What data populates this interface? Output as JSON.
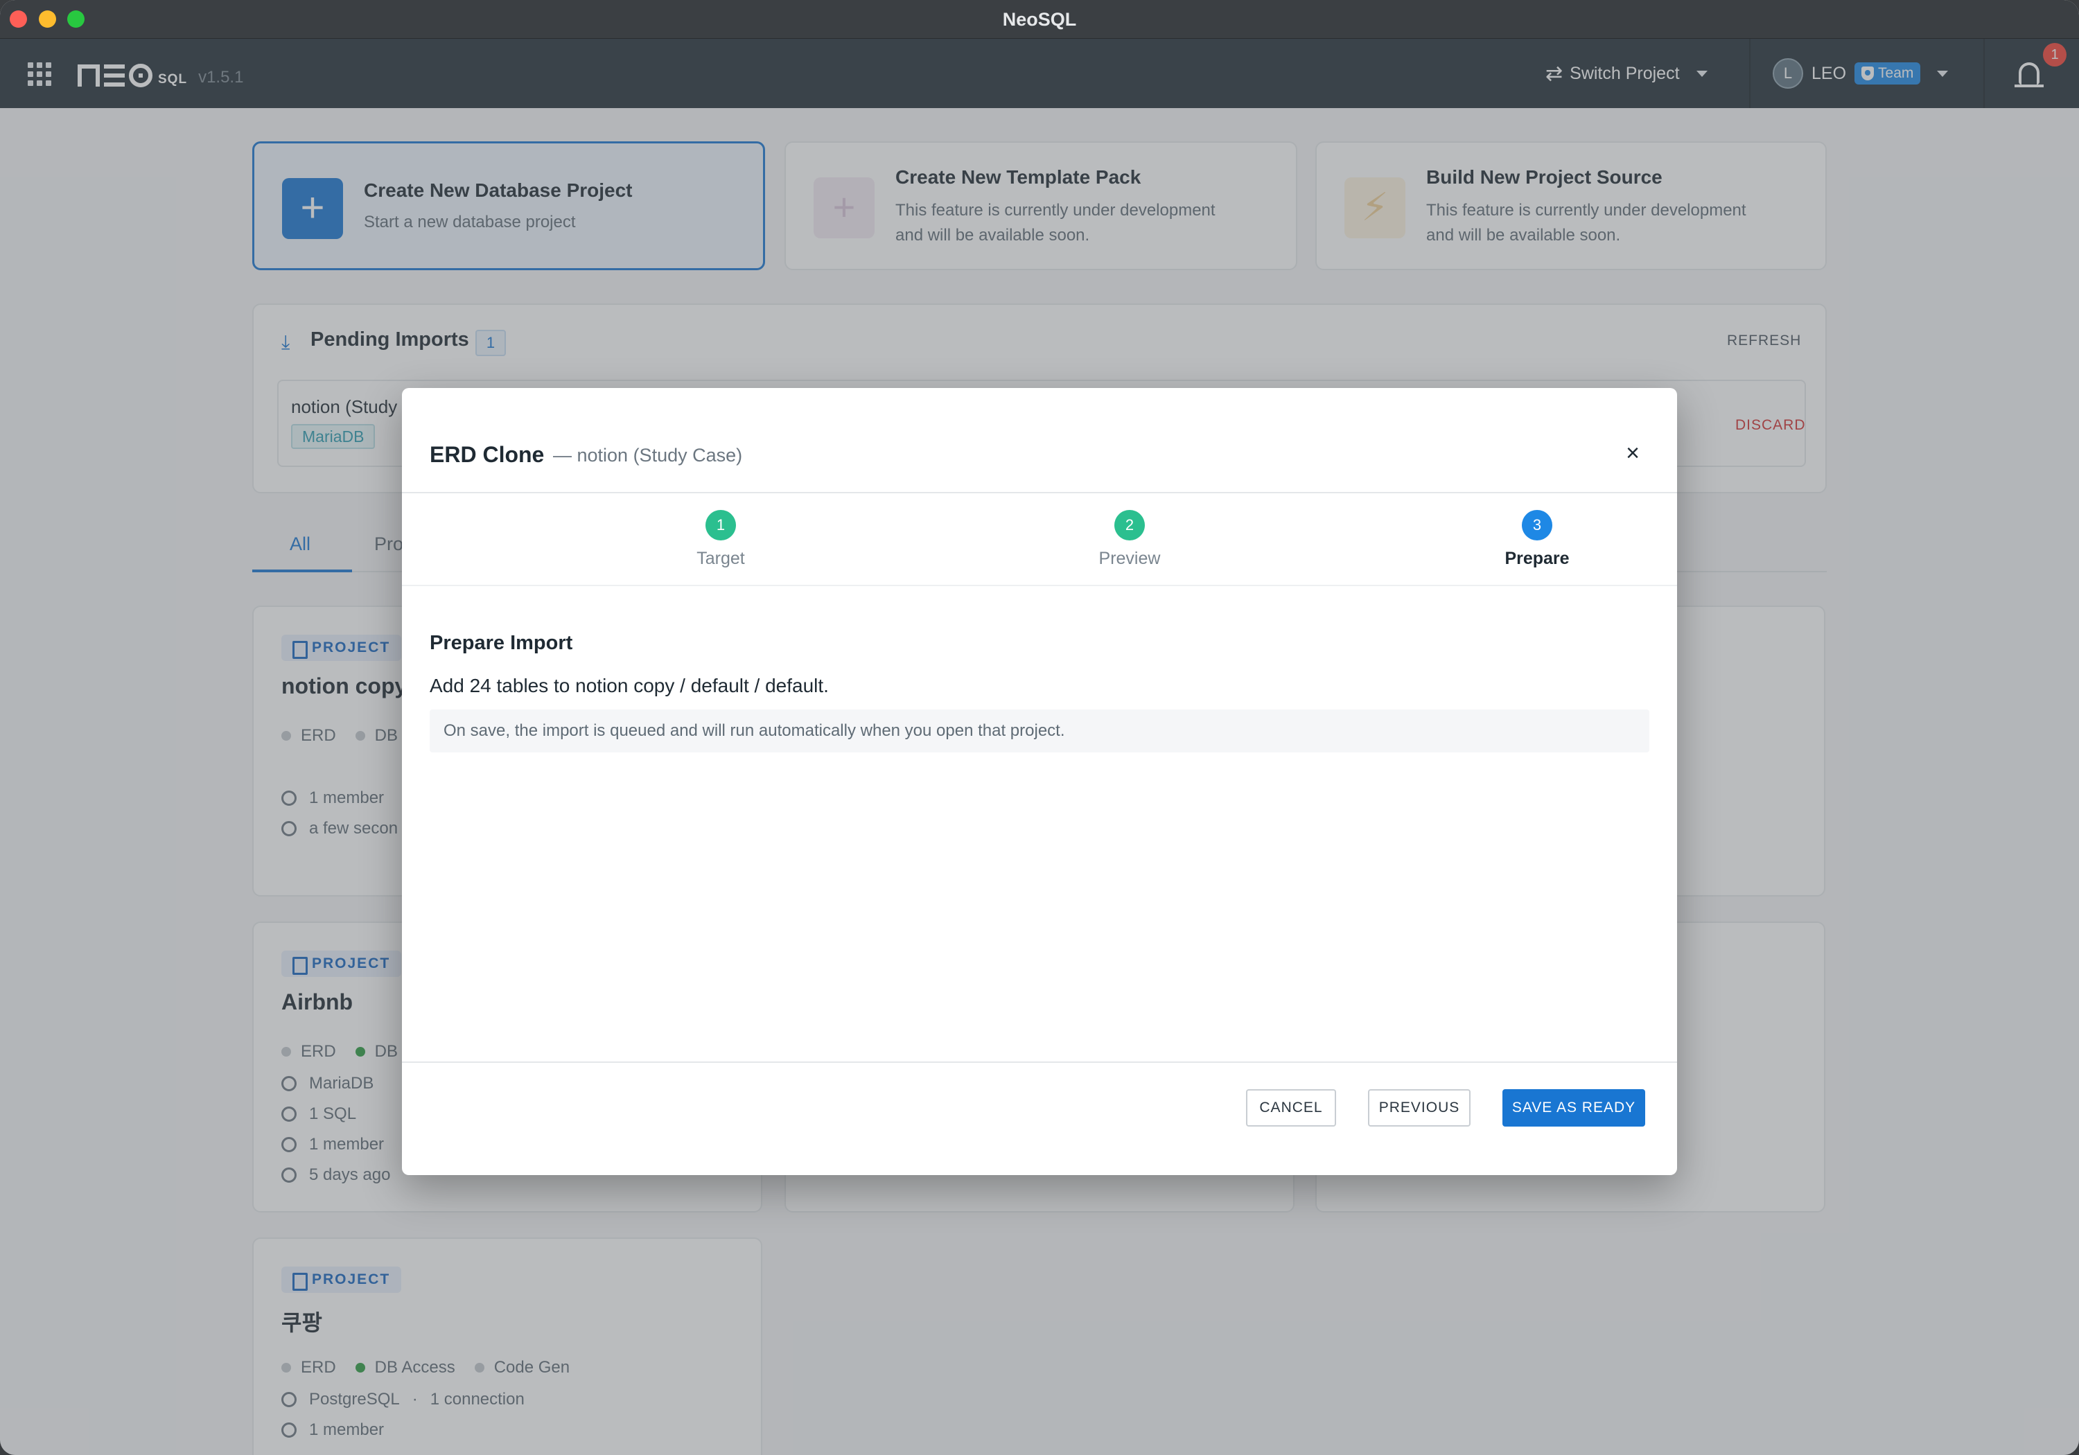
{
  "window": {
    "title": "NeoSQL"
  },
  "header": {
    "logo_sql": "SQL",
    "version": "v1.5.1",
    "switch_project": "Switch Project",
    "user_initial": "L",
    "user_name": "LEO",
    "team_badge": "Team",
    "notification_count": "1"
  },
  "create_cards": [
    {
      "title": "Create New Database Project",
      "subtitle": "Start a new database project",
      "icon": "plus-icon"
    },
    {
      "title": "Create New Template Pack",
      "subtitle_line1": "This feature is currently under development",
      "subtitle_line2": "and will be available soon.",
      "icon": "plus-icon"
    },
    {
      "title": "Build New Project Source",
      "subtitle_line1": "This feature is currently under development",
      "subtitle_line2": "and will be available soon.",
      "icon": "lightning-icon"
    }
  ],
  "pending": {
    "title": "Pending Imports",
    "count": "1",
    "refresh": "REFRESH",
    "item_name": "notion (Study",
    "item_tag": "MariaDB",
    "discard": "DISCARD"
  },
  "tabs": {
    "all": "All",
    "pro": "Pro"
  },
  "projects": [
    {
      "tag": "PROJECT",
      "name": "notion copy",
      "erd": "ERD",
      "db": "DB",
      "members": "1 member",
      "time": "a few secon"
    },
    {
      "tag": "PROJECT",
      "name": "Airbnb",
      "erd": "ERD",
      "db": "DB",
      "engine": "MariaDB",
      "sql": "1 SQL",
      "members": "1 member",
      "time": "5 days ago"
    },
    {
      "tag": "PROJECT",
      "name": "쿠팡",
      "erd": "ERD",
      "db": "DB Access",
      "codegen": "Code Gen",
      "engine": "PostgreSQL",
      "connections": "1 connection",
      "members": "1 member"
    }
  ],
  "modal": {
    "title": "ERD Clone",
    "subtitle": "— notion (Study Case)",
    "steps": [
      {
        "num": "1",
        "label": "Target",
        "state": "done"
      },
      {
        "num": "2",
        "label": "Preview",
        "state": "done"
      },
      {
        "num": "3",
        "label": "Prepare",
        "state": "active"
      }
    ],
    "section_title": "Prepare Import",
    "section_body": "Add 24 tables to notion copy / default / default.",
    "info": "On save, the import is queued and will run automatically when you open that project.",
    "cancel": "CANCEL",
    "previous": "PREVIOUS",
    "save": "SAVE AS READY"
  },
  "colors": {
    "primary": "#1976d2",
    "step_done": "#2bbf8f",
    "step_active": "#1e88e5",
    "header_bg": "#243038",
    "danger": "#d32f2f"
  }
}
